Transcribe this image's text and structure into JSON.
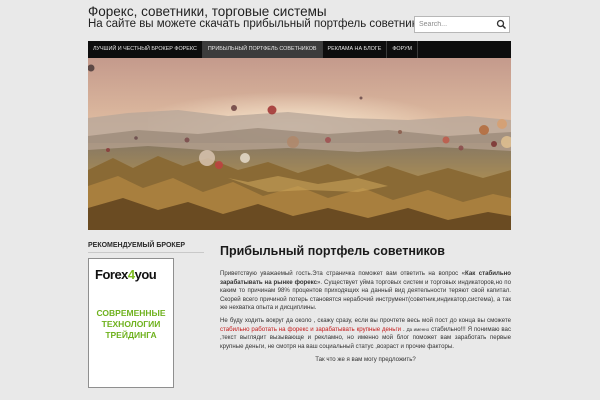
{
  "site": {
    "title": "Форекс, советники, торговые системы",
    "description": "На сайте вы можете скачать прибыльный портфель советников"
  },
  "search": {
    "placeholder": "Search..."
  },
  "nav": {
    "items": [
      {
        "label": "ЛУЧШИЙ И ЧЕСТНЫЙ БРОКЕР ФОРЕКС"
      },
      {
        "label": "ПРИБЫЛЬНЫЙ ПОРТФЕЛЬ СОВЕТНИКОВ"
      },
      {
        "label": "РЕКЛАМА НА БЛОГЕ"
      },
      {
        "label": "ФОРУМ"
      }
    ]
  },
  "sidebar": {
    "heading": "РЕКОМЕНДУЕМЫЙ БРОКЕР",
    "ad": {
      "logo_pre": "Forex",
      "logo_num": "4",
      "logo_post": "you",
      "line1": "СОВРЕМЕННЫЕ",
      "line2": "ТЕХНОЛОГИИ",
      "line3": "ТРЕЙДИНГА"
    }
  },
  "post": {
    "title": "Прибыльный портфель советников",
    "p1_a": "Приветствую уважаемый гость.Эта страничка поможет вам ответить на вопрос «",
    "p1_bold": "Как стабильно зарабатывать на рынке форекс",
    "p1_b": "». Существует уйма торговых систем и торговых индикаторов,но по каким то причинам 98% процентов приходящих на данный вид деятельности теряют свой капитал. Скорей всего причиной потерь становятся нерабочий инструмент(советник,индикатор,система), а так же нехватка опыта и дисциплины.",
    "p2_a": "Не буду ходить вокруг да около , скажу сразу, если вы прочтете весь мой пост до конца вы сможете ",
    "p2_link": "стабильно работать на форекс и зарабатывать крупные деньги",
    "p2_small": "Да именно",
    "p2_b": "стабильно!!! Я понимаю вас ,текст выглядит вызывающе и рекламно, но именно мой блог поможет вам заработать первые крупные деньги, не смотря на ваш социальный статус ,возраст и прочие факторы.",
    "question": "Так что же я вам могу предложить?"
  },
  "colors": {
    "nav_bg": "#0d0d0d",
    "nav_active": "#3c3c3c",
    "link": "#c41a1a",
    "ad_green": "#6fb21e"
  }
}
